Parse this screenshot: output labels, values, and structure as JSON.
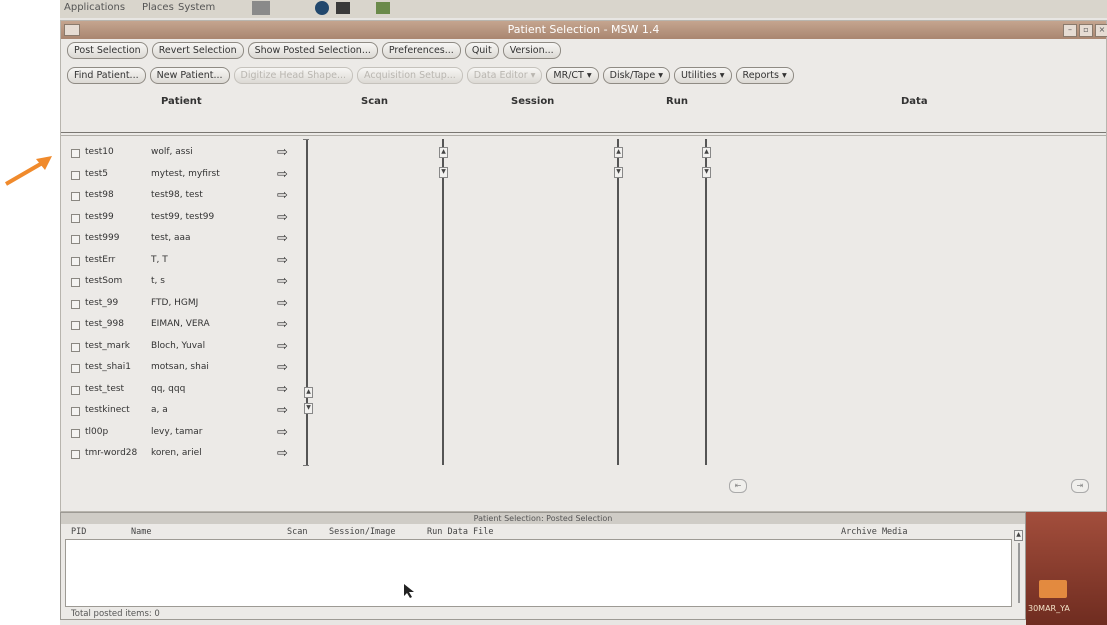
{
  "panel": {
    "apps_label": "Applications",
    "places_label": "Places",
    "system_label": "System"
  },
  "window": {
    "title": "Patient Selection - MSW 1.4"
  },
  "toolbar1": [
    {
      "name": "post-selection-button",
      "label": "Post Selection",
      "disabled": false
    },
    {
      "name": "revert-selection-button",
      "label": "Revert Selection",
      "disabled": false
    },
    {
      "name": "show-posted-selection-button",
      "label": "Show Posted Selection...",
      "disabled": false
    },
    {
      "name": "preferences-button",
      "label": "Preferences...",
      "disabled": false
    },
    {
      "name": "quit-button",
      "label": "Quit",
      "disabled": false
    },
    {
      "name": "version-button",
      "label": "Version...",
      "disabled": false
    }
  ],
  "toolbar2": [
    {
      "name": "find-patient-button",
      "label": "Find Patient...",
      "disabled": false
    },
    {
      "name": "new-patient-button",
      "label": "New Patient...",
      "disabled": false
    },
    {
      "name": "digitize-head-shape-button",
      "label": "Digitize Head Shape...",
      "disabled": true
    },
    {
      "name": "acquisition-setup-button",
      "label": "Acquisition Setup...",
      "disabled": true
    },
    {
      "name": "data-editor-button",
      "label": "Data Editor ▾",
      "disabled": true
    },
    {
      "name": "mr-ct-menu",
      "label": "MR/CT ▾",
      "disabled": false
    },
    {
      "name": "disk-tape-menu",
      "label": "Disk/Tape ▾",
      "disabled": false
    },
    {
      "name": "utilities-menu",
      "label": "Utilities ▾",
      "disabled": false
    },
    {
      "name": "reports-menu",
      "label": "Reports ▾",
      "disabled": false
    }
  ],
  "columns": {
    "patient": "Patient",
    "scan": "Scan",
    "session": "Session",
    "run": "Run",
    "data": "Data"
  },
  "patients": [
    {
      "id": "test10",
      "name": "wolf, assi"
    },
    {
      "id": "test5",
      "name": "mytest, myfirst"
    },
    {
      "id": "test98",
      "name": "test98, test"
    },
    {
      "id": "test99",
      "name": "test99, test99"
    },
    {
      "id": "test999",
      "name": "test, aaa"
    },
    {
      "id": "testErr",
      "name": "T, T"
    },
    {
      "id": "testSom",
      "name": "t, s"
    },
    {
      "id": "test_99",
      "name": "FTD, HGMJ"
    },
    {
      "id": "test_998",
      "name": "EIMAN, VERA"
    },
    {
      "id": "test_mark",
      "name": "Bloch, Yuval"
    },
    {
      "id": "test_shai1",
      "name": "motsan, shai"
    },
    {
      "id": "test_test",
      "name": "qq, qqq"
    },
    {
      "id": "testkinect",
      "name": "a, a"
    },
    {
      "id": "tl00p",
      "name": "levy, tamar"
    },
    {
      "id": "tmr-word28",
      "name": "koren, ariel"
    }
  ],
  "row_arrow": "⇨",
  "posted": {
    "title": "Patient Selection: Posted Selection",
    "headers": {
      "pid": "PID",
      "name": "Name",
      "scan": "Scan",
      "session": "Session/Image",
      "run": "Run Data File",
      "archive": "Archive Media"
    },
    "status": "Total posted items: 0"
  },
  "desktop": {
    "folder_label": "30MAR_YA"
  },
  "colors": {
    "annotation_arrow": "#f08a2c",
    "titlebar": "#b08e78"
  }
}
